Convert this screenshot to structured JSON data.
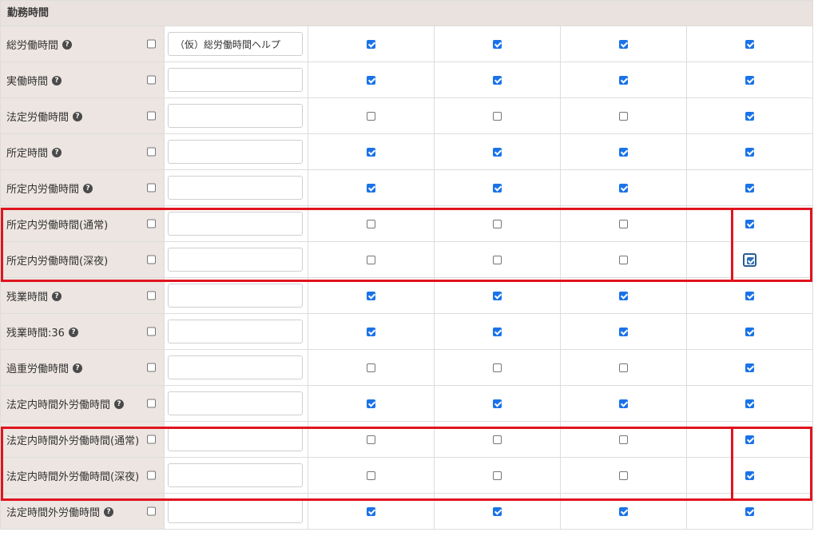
{
  "section": {
    "title": "勤務時間"
  },
  "rows": [
    {
      "label": "総労働時間",
      "help": true,
      "input": "（仮）総労働時間ヘルプ",
      "checks": [
        true,
        true,
        true,
        true
      ]
    },
    {
      "label": "実働時間",
      "help": true,
      "input": "",
      "checks": [
        true,
        true,
        true,
        true
      ]
    },
    {
      "label": "法定労働時間",
      "help": true,
      "input": "",
      "checks": [
        false,
        false,
        false,
        true
      ]
    },
    {
      "label": "所定時間",
      "help": true,
      "input": "",
      "checks": [
        true,
        true,
        true,
        true
      ]
    },
    {
      "label": "所定内労働時間",
      "help": true,
      "input": "",
      "checks": [
        true,
        true,
        true,
        true
      ]
    },
    {
      "label": "所定内労働時間(通常)",
      "help": false,
      "input": "",
      "checks": [
        false,
        false,
        false,
        true
      ]
    },
    {
      "label": "所定内労働時間(深夜)",
      "help": false,
      "input": "",
      "checks": [
        false,
        false,
        false,
        true
      ],
      "focus_col": 3
    },
    {
      "label": "残業時間",
      "help": true,
      "input": "",
      "checks": [
        true,
        true,
        true,
        true
      ]
    },
    {
      "label": "残業時間:36",
      "help": true,
      "input": "",
      "checks": [
        true,
        true,
        true,
        true
      ]
    },
    {
      "label": "過重労働時間",
      "help": true,
      "input": "",
      "checks": [
        false,
        false,
        false,
        true
      ]
    },
    {
      "label": "法定内時間外労働時間",
      "help": true,
      "input": "",
      "checks": [
        true,
        true,
        true,
        true
      ]
    },
    {
      "label": "法定内時間外労働時間(通常)",
      "help": false,
      "input": "",
      "checks": [
        false,
        false,
        false,
        true
      ]
    },
    {
      "label": "法定内時間外労働時間(深夜)",
      "help": false,
      "input": "",
      "checks": [
        false,
        false,
        false,
        true
      ]
    },
    {
      "label": "法定時間外労働時間",
      "help": true,
      "input": "",
      "checks": [
        true,
        true,
        true,
        true
      ]
    }
  ],
  "colors": {
    "checked": "#1a73e8",
    "highlight": "#e0141e",
    "label_bg": "#ece5e1",
    "header_bg": "#e9e2de"
  }
}
